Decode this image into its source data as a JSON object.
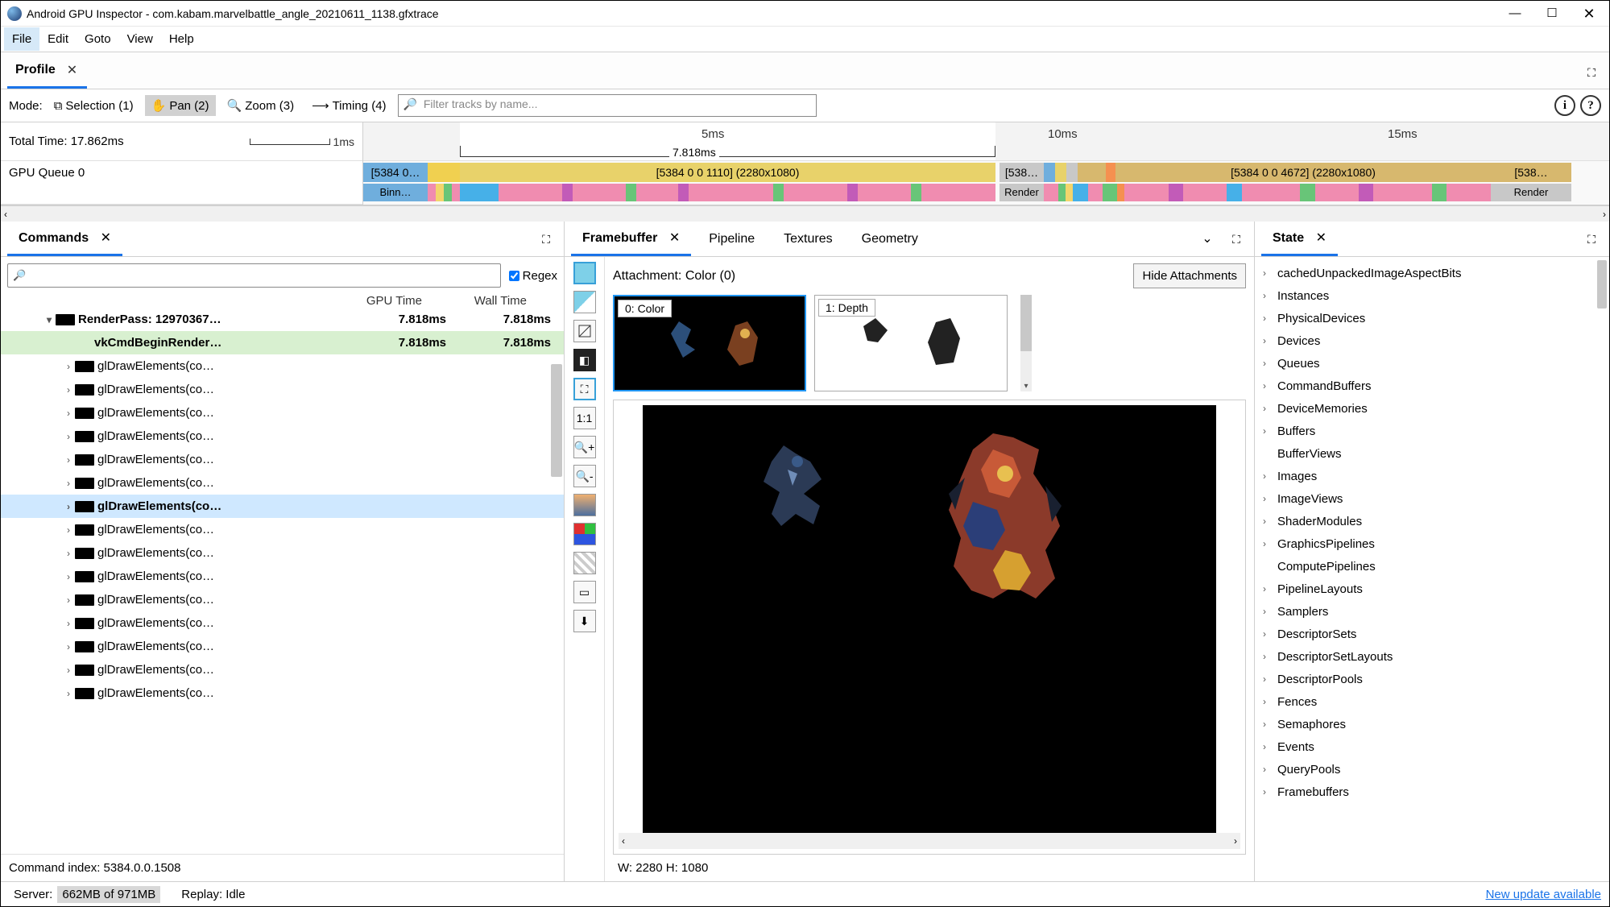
{
  "title": "Android GPU Inspector - com.kabam.marvelbattle_angle_20210611_1138.gfxtrace",
  "menu": [
    "File",
    "Edit",
    "Goto",
    "View",
    "Help"
  ],
  "profile_tab": "Profile",
  "mode": {
    "label": "Mode:",
    "selection": "Selection (1)",
    "pan": "Pan (2)",
    "zoom": "Zoom (3)",
    "timing": "Timing (4)",
    "filter_placeholder": "Filter tracks by name..."
  },
  "timeline": {
    "total_time": "Total Time: 17.862ms",
    "mini_unit": "1ms",
    "queue_label": "GPU Queue 0",
    "ticks": {
      "t5": "5ms",
      "t10": "10ms",
      "t15": "15ms"
    },
    "selected_span": "7.818ms",
    "seg0": "[5384 0…",
    "seg1": "[5384 0 0 1110] (2280x1080)",
    "seg2": "[538…",
    "seg3": "[5384 0 0 4672] (2280x1080)",
    "seg4": "[538…",
    "sub0": "Binn…",
    "sub2": "Render",
    "sub4": "Render"
  },
  "commands": {
    "title": "Commands",
    "regex": "Regex",
    "hdr_gpu": "GPU Time",
    "hdr_wall": "Wall Time",
    "rows": [
      {
        "indent": 2,
        "chev": "▾",
        "name": "RenderPass: 12970367…",
        "gpu": "7.818ms",
        "wall": "7.818ms",
        "bold": true
      },
      {
        "indent": 4,
        "chev": "",
        "name": "vkCmdBeginRender…",
        "gpu": "7.818ms",
        "wall": "7.818ms",
        "hl": "green",
        "noicon": true
      },
      {
        "indent": 3,
        "chev": "›",
        "name": "glDrawElements(co…"
      },
      {
        "indent": 3,
        "chev": "›",
        "name": "glDrawElements(co…"
      },
      {
        "indent": 3,
        "chev": "›",
        "name": "glDrawElements(co…"
      },
      {
        "indent": 3,
        "chev": "›",
        "name": "glDrawElements(co…"
      },
      {
        "indent": 3,
        "chev": "›",
        "name": "glDrawElements(co…"
      },
      {
        "indent": 3,
        "chev": "›",
        "name": "glDrawElements(co…"
      },
      {
        "indent": 3,
        "chev": "›",
        "name": "glDrawElements(co…",
        "hl": "sel"
      },
      {
        "indent": 3,
        "chev": "›",
        "name": "glDrawElements(co…"
      },
      {
        "indent": 3,
        "chev": "›",
        "name": "glDrawElements(co…"
      },
      {
        "indent": 3,
        "chev": "›",
        "name": "glDrawElements(co…"
      },
      {
        "indent": 3,
        "chev": "›",
        "name": "glDrawElements(co…"
      },
      {
        "indent": 3,
        "chev": "›",
        "name": "glDrawElements(co…"
      },
      {
        "indent": 3,
        "chev": "›",
        "name": "glDrawElements(co…"
      },
      {
        "indent": 3,
        "chev": "›",
        "name": "glDrawElements(co…"
      },
      {
        "indent": 3,
        "chev": "›",
        "name": "glDrawElements(co…"
      }
    ],
    "footer": "Command index: 5384.0.0.1508"
  },
  "fb": {
    "tabs": [
      "Framebuffer",
      "Pipeline",
      "Textures",
      "Geometry"
    ],
    "attachment": "Attachment: Color (0)",
    "hide": "Hide Attachments",
    "thumb0": "0: Color",
    "thumb1": "1: Depth",
    "wh": "W: 2280 H: 1080"
  },
  "state": {
    "title": "State",
    "items": [
      "cachedUnpackedImageAspectBits",
      "Instances",
      "PhysicalDevices",
      "Devices",
      "Queues",
      "CommandBuffers",
      "DeviceMemories",
      "Buffers",
      "BufferViews",
      "Images",
      "ImageViews",
      "ShaderModules",
      "GraphicsPipelines",
      "ComputePipelines",
      "PipelineLayouts",
      "Samplers",
      "DescriptorSets",
      "DescriptorSetLayouts",
      "DescriptorPools",
      "Fences",
      "Semaphores",
      "Events",
      "QueryPools",
      "Framebuffers"
    ],
    "no_chev": [
      "BufferViews",
      "ComputePipelines"
    ]
  },
  "status": {
    "server_pre": "Server:",
    "server_val": "662MB of 971MB",
    "replay": "Replay: Idle",
    "update": "New update available"
  }
}
